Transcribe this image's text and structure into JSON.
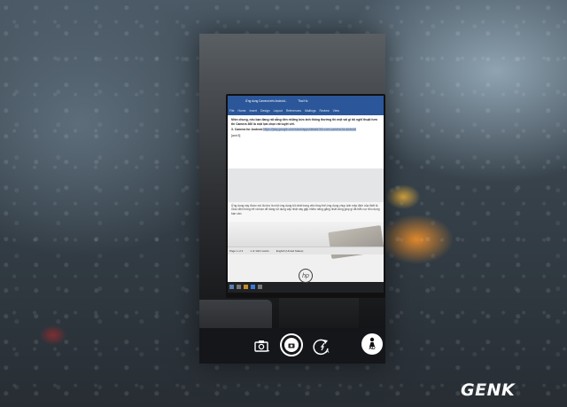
{
  "word": {
    "title_text": "Ứng dụng Camera trên Android...",
    "title_user": "Thai Ho",
    "menu": [
      "File",
      "Home",
      "Insert",
      "Design",
      "Layout",
      "References",
      "Mailings",
      "Review",
      "View"
    ]
  },
  "document": {
    "para1": "Nhìn chung, nếu bạn đang rất sẵng tiền những bức ảnh thông thường thì một vài gì tôi nghĩ thuật hơn thì Camera 360 là một lựa chọn rất tuyệt vời.",
    "heading": "3. Camera for Android",
    "link": "https://play.google.com/store/apps/details?id=com.camera.for.android",
    "image_note": "[anh 5]",
    "para2": "Ứng dụng này được mô tả như là một ứng dụng tốt nhất trong việc thay thế ứng dụng chụp ảnh mặc định của thiết bị. Giao diện trông trẻ và bạn dễ dàng sử dụng cập nhật này gặp nhiều nâng gắng nhất cũng giúp gi đã biểu sự hữu dụng bạn cần."
  },
  "statusbar": {
    "page": "Page 1 of 4",
    "words": "1 of 1421 words",
    "language": "English (United States)"
  },
  "camera": {
    "lens_label": "AD"
  },
  "watermark": {
    "brand_g": "G",
    "brand_e": "E",
    "brand_n": "N",
    "brand_k": "K"
  },
  "colors": {
    "word_blue": "#2b579a",
    "genk_accent": "#f5a623"
  },
  "icons": [
    "camera-icon",
    "shutter-icon",
    "switch-camera-icon",
    "lens-icon"
  ]
}
